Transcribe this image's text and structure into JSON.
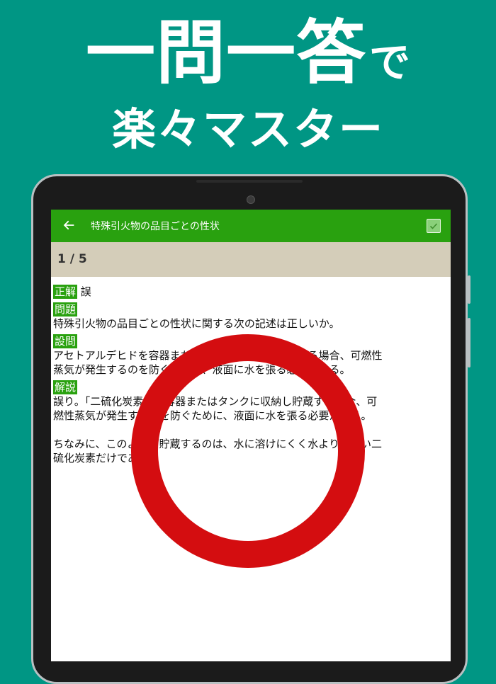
{
  "promo": {
    "headline_big": "一問一答",
    "headline_small": "で",
    "subline": "楽々マスター"
  },
  "appbar": {
    "title": "特殊引火物の品目ごとの性状",
    "back_icon": "arrow-left-icon",
    "action_icon": "checkbox-icon"
  },
  "progress": {
    "text": "1 / 5"
  },
  "content": {
    "answer_tag": "正解",
    "answer_value": "誤",
    "question_tag": "問題",
    "question_text": "特殊引火物の品目ごとの性状に関する次の記述は正しいか。",
    "statement_tag": "設問",
    "statement_line1": "アセトアルデヒドを容器またはタンクに収納し貯蔵する場合、可燃性",
    "statement_line2": "蒸気が発生するのを防ぐために、液面に水を張る必要がある。",
    "explanation_tag": "解説",
    "explanation_line1": "誤り。「二硫化炭素」を容器またはタンクに収納し貯蔵する場合、可",
    "explanation_line2": "燃性蒸気が発生するのを防ぐために、液面に水を張る必要がある。",
    "note_line1": "ちなみに、このように貯蔵するのは、水に溶けにくく水よりも重い二",
    "note_line2": "硫化炭素だけである。"
  },
  "colors": {
    "background": "#009684",
    "appbar": "#29a10f",
    "progress_bar": "#d4cdb9",
    "correct_mark": "#d40d10"
  },
  "overlay": {
    "icon": "correct-circle-icon"
  }
}
